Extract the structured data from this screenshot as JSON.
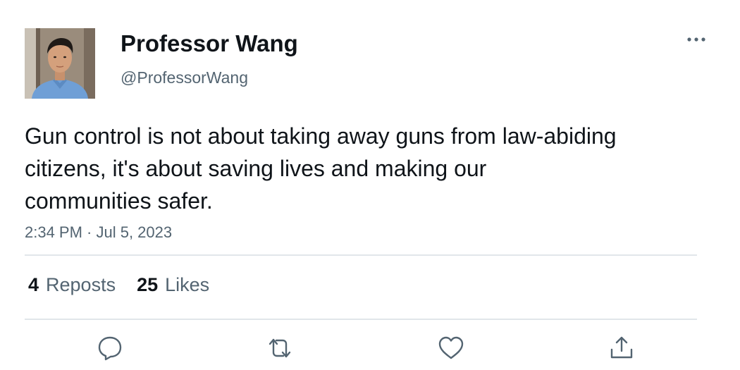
{
  "author": {
    "display_name": "Professor Wang",
    "handle": "@ProfessorWang",
    "avatar": "avatar-photo"
  },
  "tweet": {
    "text": "Gun control is not about taking away guns from law-abiding citizens, it's about saving lives and making our communities safer.",
    "timestamp": "2:34 PM · Jul 5, 2023"
  },
  "stats": {
    "reposts_count": "4",
    "reposts_label": "Reposts",
    "likes_count": "25",
    "likes_label": "Likes"
  },
  "actions": {
    "more": "more-icon",
    "reply": "reply-icon",
    "repost": "repost-icon",
    "like": "like-icon",
    "share": "share-icon"
  },
  "colors": {
    "text_primary": "#0f1419",
    "text_secondary": "#536471",
    "divider": "#e1e6ea"
  }
}
